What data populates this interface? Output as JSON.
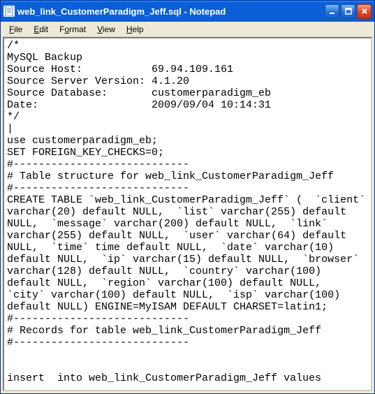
{
  "window": {
    "title": "web_link_CustomerParadigm_Jeff.sql - Notepad"
  },
  "menu": {
    "file": "File",
    "edit": "Edit",
    "format": "Format",
    "view": "View",
    "help": "Help"
  },
  "controls": {
    "minimize": "Minimize",
    "maximize": "Maximize",
    "close": "Close"
  },
  "editor": {
    "content": "/*\nMySQL Backup\nSource Host:           69.94.109.161\nSource Server Version: 4.1.20\nSource Database:       customerparadigm_eb\nDate:                  2009/09/04 10:14:31\n*/\n|\nuse customerparadigm_eb;\nSET FOREIGN_KEY_CHECKS=0;\n#----------------------------\n# Table structure for web_link_CustomerParadigm_Jeff\n#----------------------------\nCREATE TABLE `web_link_CustomerParadigm_Jeff` (  `client` varchar(20) default NULL,  `list` varchar(255) default NULL,  `message` varchar(200) default NULL,  `link` varchar(255) default NULL,  `user` varchar(64) default NULL,  `time` time default NULL,  `date` varchar(10) default NULL,  `ip` varchar(15) default NULL,  `browser` varchar(128) default NULL,  `country` varchar(100) default NULL,  `region` varchar(100) default NULL,  `city` varchar(100) default NULL,  `isp` varchar(100) default NULL) ENGINE=MyISAM DEFAULT CHARSET=latin1;\n#----------------------------\n# Records for table web_link_CustomerParadigm_Jeff\n#----------------------------\n\n\ninsert  into web_link_CustomerParadigm_Jeff values "
  }
}
